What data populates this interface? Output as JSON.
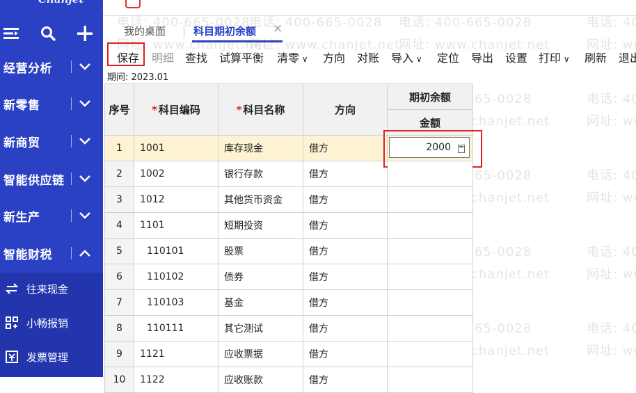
{
  "brand": "Chanjet",
  "sidebar": {
    "top_icons": [
      "menu-icon",
      "search-icon",
      "plus-icon"
    ],
    "menu": [
      {
        "label": "经营分析",
        "chevron": "down"
      },
      {
        "label": "新零售",
        "chevron": "down"
      },
      {
        "label": "新商贸",
        "chevron": "down"
      },
      {
        "label": "智能供应链",
        "chevron": "down"
      },
      {
        "label": "新生产",
        "chevron": "down"
      },
      {
        "label": "智能财税",
        "chevron": "up"
      }
    ],
    "sub_items": [
      {
        "label": "往来现金",
        "icon": "transfer-icon"
      },
      {
        "label": "小畅报销",
        "icon": "grid-icon"
      },
      {
        "label": "发票管理",
        "icon": "invoice-icon"
      }
    ]
  },
  "tabs": [
    {
      "label": "我的桌面",
      "active": false
    },
    {
      "label": "科目期初余额",
      "active": true
    }
  ],
  "toolbar": {
    "save": "保存",
    "detail": "明细",
    "find": "查找",
    "trial_balance": "试算平衡",
    "clear": "清零",
    "direction": "方向",
    "reconcile": "对账",
    "import": "导入",
    "locate": "定位",
    "export": "导出",
    "settings": "设置",
    "print": "打印",
    "refresh": "刷新",
    "exit": "退出"
  },
  "period": "期间: 2023.01",
  "table": {
    "headers": {
      "index": "序号",
      "code": "科目编码",
      "name": "科目名称",
      "direction": "方向",
      "opening_balance": "期初余额",
      "amount": "金额"
    },
    "rows": [
      {
        "idx": "1",
        "code": "1001",
        "name": "库存现金",
        "dir": "借方",
        "amount": "2000",
        "sub": false
      },
      {
        "idx": "2",
        "code": "1002",
        "name": "银行存款",
        "dir": "借方",
        "amount": "",
        "sub": false
      },
      {
        "idx": "3",
        "code": "1012",
        "name": "其他货币资金",
        "dir": "借方",
        "amount": "",
        "sub": false
      },
      {
        "idx": "4",
        "code": "1101",
        "name": "短期投资",
        "dir": "借方",
        "amount": "",
        "sub": false
      },
      {
        "idx": "5",
        "code": "110101",
        "name": "股票",
        "dir": "借方",
        "amount": "",
        "sub": true
      },
      {
        "idx": "6",
        "code": "110102",
        "name": "债券",
        "dir": "借方",
        "amount": "",
        "sub": true
      },
      {
        "idx": "7",
        "code": "110103",
        "name": "基金",
        "dir": "借方",
        "amount": "",
        "sub": true
      },
      {
        "idx": "8",
        "code": "110111",
        "name": "其它测试",
        "dir": "借方",
        "amount": "",
        "sub": true
      },
      {
        "idx": "9",
        "code": "1121",
        "name": "应收票据",
        "dir": "借方",
        "amount": "",
        "sub": false
      },
      {
        "idx": "10",
        "code": "1122",
        "name": "应收账款",
        "dir": "借方",
        "amount": "",
        "sub": false
      }
    ]
  },
  "watermark": {
    "phone": "电话: 400-665-0028",
    "site": "网址: www.chanjet.net"
  },
  "colors": {
    "sidebar": "#2a41c4",
    "accent": "#2a41c4",
    "highlight": "#e02020",
    "selected_row": "#fdf3d3"
  }
}
